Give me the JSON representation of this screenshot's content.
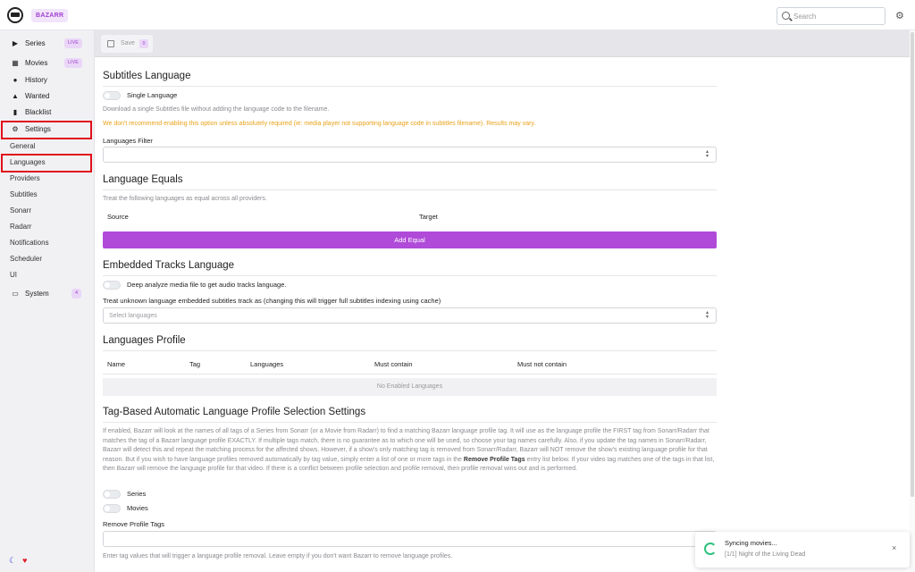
{
  "header": {
    "brand": "BAZARR",
    "search_placeholder": "Search",
    "settings_icon": "gear-icon"
  },
  "sidebar": {
    "items": [
      {
        "label": "Series",
        "icon": "play-icon",
        "badge": "LIVE"
      },
      {
        "label": "Movies",
        "icon": "film-icon",
        "badge": "LIVE"
      },
      {
        "label": "History",
        "icon": "clock-icon"
      },
      {
        "label": "Wanted",
        "icon": "warning-icon"
      },
      {
        "label": "Blacklist",
        "icon": "file-icon"
      },
      {
        "label": "Settings",
        "icon": "cogs-icon"
      }
    ],
    "settings_sub": [
      "General",
      "Languages",
      "Providers",
      "Subtitles",
      "Sonarr",
      "Radarr",
      "Notifications",
      "Scheduler",
      "UI"
    ],
    "system": {
      "label": "System",
      "icon": "laptop-icon",
      "badge": "4"
    },
    "highlight_color": "#e0101a"
  },
  "toolbar": {
    "save_label": "Save",
    "save_count": "0"
  },
  "main": {
    "subtitles_language": {
      "title": "Subtitles Language",
      "single_language_label": "Single Language",
      "single_language_desc": "Download a single Subtitles file without adding the language code to the filename.",
      "warning": "We don't recommend enabling this option unless absolutely required (ie: media player not supporting language code in subtitles filename). Results may vary.",
      "filter_label": "Languages Filter"
    },
    "language_equals": {
      "title": "Language Equals",
      "desc": "Treat the following languages as equal across all providers.",
      "col_source": "Source",
      "col_target": "Target",
      "add_button": "Add Equal"
    },
    "embedded": {
      "title": "Embedded Tracks Language",
      "deep_analyze_label": "Deep analyze media file to get audio tracks language.",
      "unknown_label": "Treat unknown language embedded subtitles track as (changing this will trigger full subtitles indexing using cache)",
      "select_placeholder": "Select languages"
    },
    "profile": {
      "title": "Languages Profile",
      "columns": [
        "Name",
        "Tag",
        "Languages",
        "Must contain",
        "Must not contain"
      ],
      "empty": "No Enabled Languages"
    },
    "tag_based": {
      "title": "Tag-Based Automatic Language Profile Selection Settings",
      "desc_part1": "If enabled, Bazarr will look at the names of all tags of a Series from Sonarr (or a Movie from Radarr) to find a matching Bazarr language profile tag. It will use as the language profile the FIRST tag from Sonarr/Radarr that matches the tag of a Bazarr language profile EXACTLY. If multiple tags match, there is no guarantee as to which one will be used, so choose your tag names carefully. Also, if you update the tag names in Sonarr/Radarr, Bazarr will detect this and repeat the matching process for the affected shows. However, if a show's only matching tag is removed from Sonarr/Radarr, Bazarr will NOT remove the show's existing language profile for that reason. But if you wish to have language profiles removed automatically by tag value, simply enter a list of one or more tags in the",
      "desc_bold": "Remove Profile Tags",
      "desc_part2": "entry list below. If your video tag matches one of the tags in that list, then Bazarr will remove the language profile for that video. If there is a conflict between profile selection and profile removal, then profile removal wins out and is performed.",
      "series_label": "Series",
      "movies_label": "Movies",
      "remove_label": "Remove Profile Tags",
      "remove_desc": "Enter tag values that will trigger a language profile removal. Leave empty if you don't want Bazarr to remove language profiles."
    }
  },
  "toast": {
    "title": "Syncing movies...",
    "detail": "[1/1] Night of the Living Dead",
    "close": "×"
  },
  "colors": {
    "accent": "#b04ad8",
    "warning": "#e8a21a",
    "badge_bg": "#ead6f7",
    "spinner": "#2ec27e"
  }
}
